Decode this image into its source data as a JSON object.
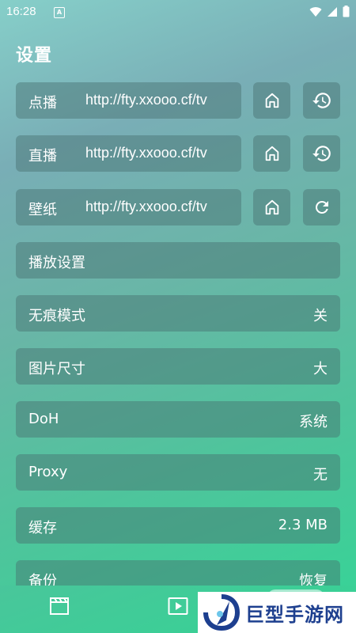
{
  "status": {
    "time": "16:28",
    "badge": "A"
  },
  "page": {
    "title": "设置"
  },
  "sources": [
    {
      "label": "点播",
      "url": "http://fty.xxooo.cf/tv",
      "actions": [
        "home-icon",
        "history-icon"
      ]
    },
    {
      "label": "直播",
      "url": "http://fty.xxooo.cf/tv",
      "actions": [
        "home-icon",
        "history-icon"
      ]
    },
    {
      "label": "壁纸",
      "url": "http://fty.xxooo.cf/tv",
      "actions": [
        "home-icon",
        "refresh-icon"
      ]
    }
  ],
  "settings": [
    {
      "label": "播放设置",
      "value": ""
    },
    {
      "label": "无痕模式",
      "value": "关"
    },
    {
      "label": "图片尺寸",
      "value": "大"
    },
    {
      "label": "DoH",
      "value": "系统"
    },
    {
      "label": "Proxy",
      "value": "无"
    },
    {
      "label": "缓存",
      "value": "2.3 MB"
    },
    {
      "label": "备份",
      "value": "恢复"
    }
  ],
  "bottom_nav": {
    "items": [
      "clapperboard-icon",
      "play-icon"
    ]
  },
  "watermark": {
    "text": "巨型手游网"
  }
}
